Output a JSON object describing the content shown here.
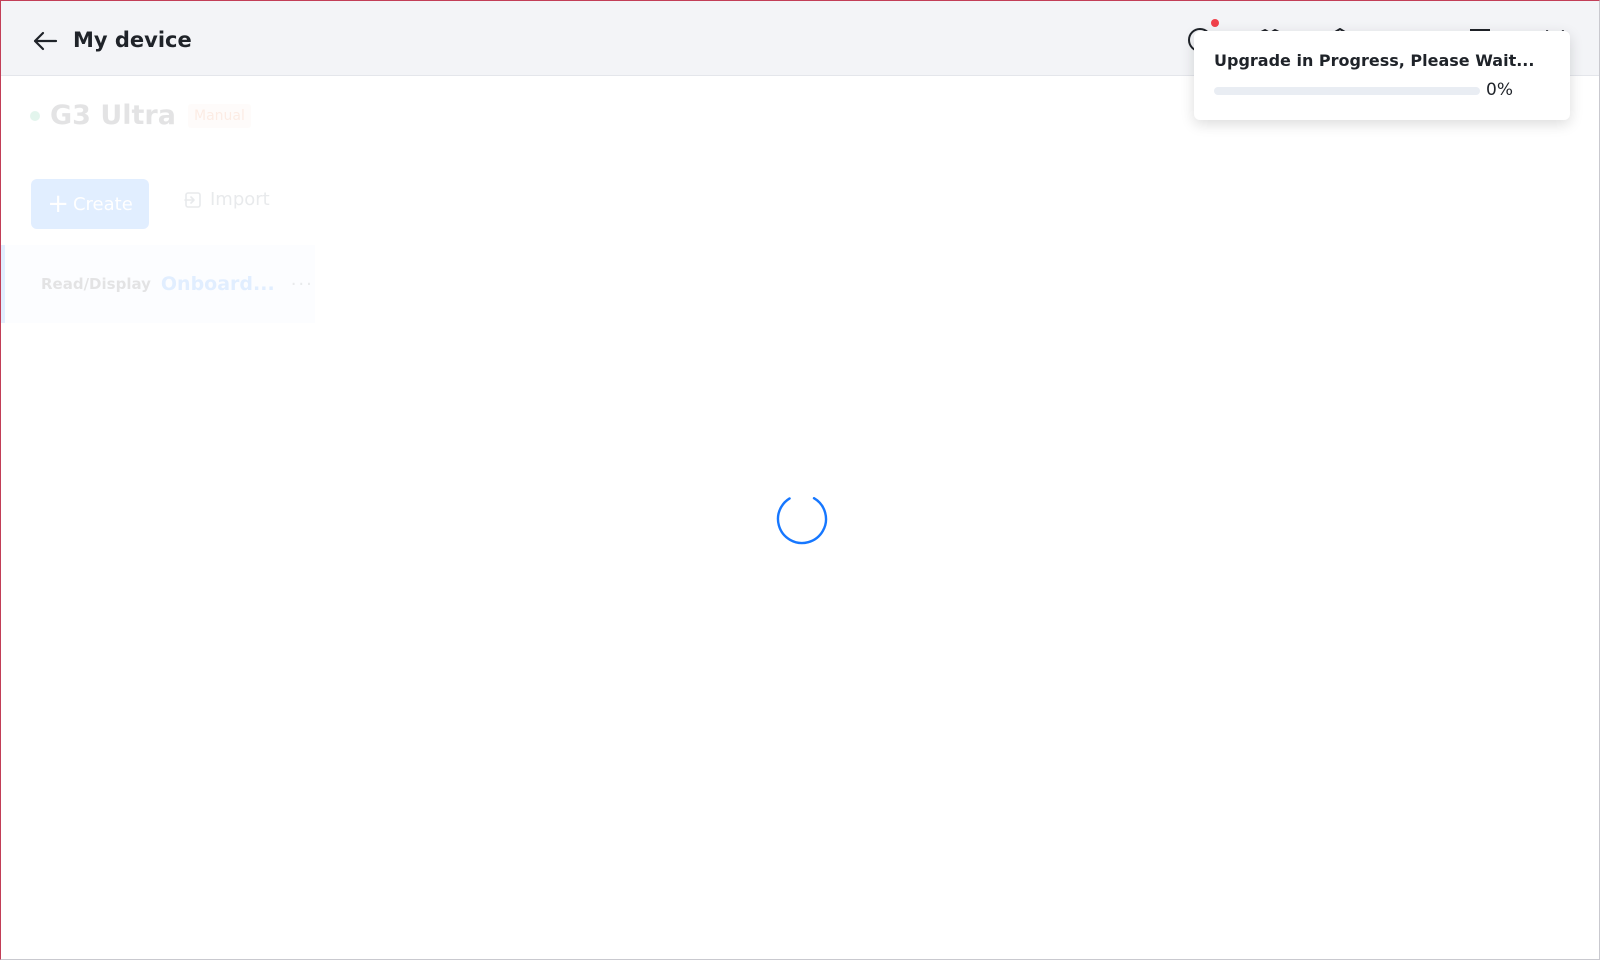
{
  "header": {
    "title": "My device",
    "icons": [
      "back-arrow-icon",
      "help-icon",
      "shield-icon",
      "home-icon",
      "minimize-icon",
      "maximize-icon",
      "close-icon"
    ]
  },
  "device": {
    "name": "G3 Ultra",
    "mode": "Manual"
  },
  "toolbar": {
    "create_label": "Create",
    "import_label": "Import"
  },
  "list": {
    "items": [
      {
        "mode": "Read/Display",
        "name": "Onboard...",
        "more": "···"
      }
    ]
  },
  "toast": {
    "title": "Upgrade in Progress, Please Wait...",
    "progress_text": "0%",
    "progress_value": 0
  },
  "colors": {
    "accent": "#1677ff",
    "badge_bg": "#fde6dc",
    "badge_text": "#e8682c",
    "notification_dot": "#f0404a"
  }
}
